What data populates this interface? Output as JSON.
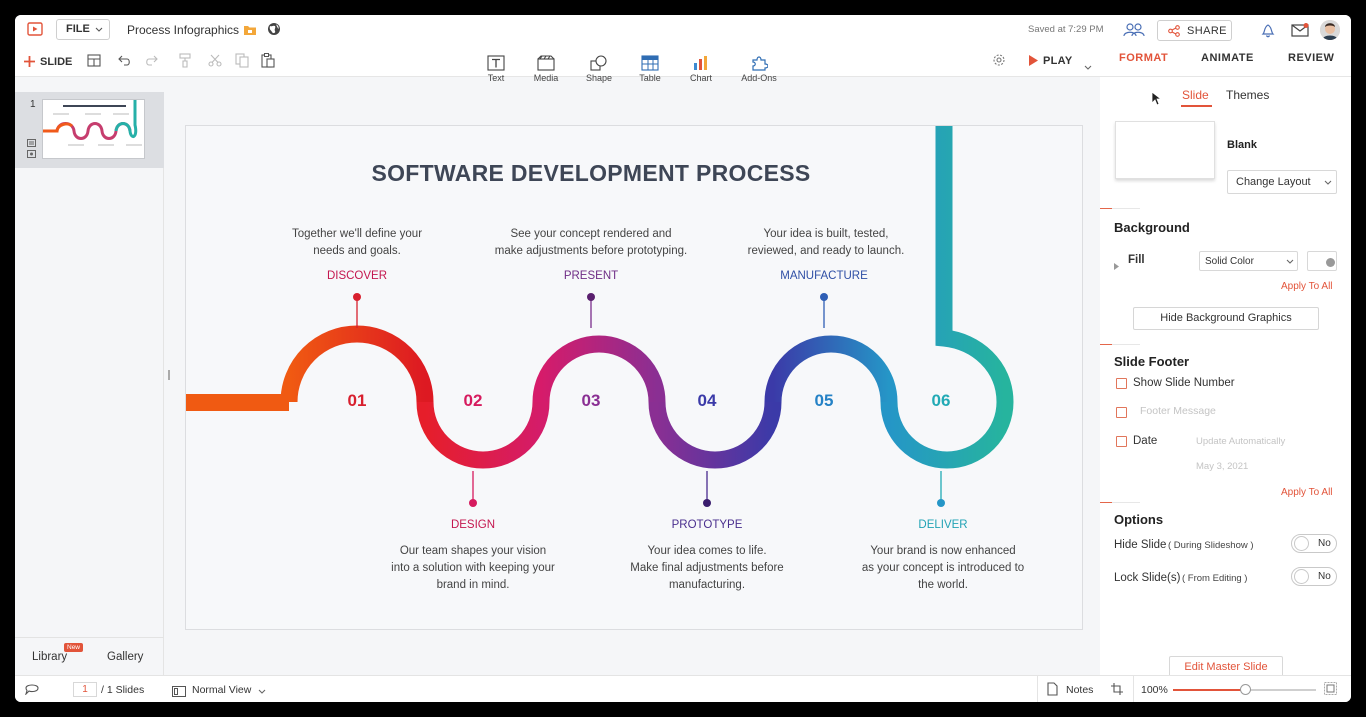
{
  "topbar": {
    "file_label": "FILE",
    "doc_title": "Process Infographics",
    "saved_status": "Saved at 7:29 PM",
    "share_label": "SHARE"
  },
  "toolbar": {
    "new_slide_label": "SLIDE",
    "insert": [
      {
        "label": "Text",
        "icon": "text-icon"
      },
      {
        "label": "Media",
        "icon": "media-icon"
      },
      {
        "label": "Shape",
        "icon": "shape-icon"
      },
      {
        "label": "Table",
        "icon": "table-icon"
      },
      {
        "label": "Chart",
        "icon": "chart-icon"
      },
      {
        "label": "Add-Ons",
        "icon": "addons-icon"
      }
    ],
    "play_label": "PLAY",
    "tabs": [
      "FORMAT",
      "ANIMATE",
      "REVIEW"
    ],
    "active_tab": "FORMAT"
  },
  "left_panel": {
    "slide_number": "1",
    "library_label": "Library",
    "library_badge": "New",
    "gallery_label": "Gallery"
  },
  "slide": {
    "title": "SOFTWARE DEVELOPMENT PROCESS",
    "steps": [
      {
        "num": "01",
        "name": "DISCOVER",
        "desc1": "Together we'll define your",
        "desc2": "needs and goals.",
        "desc3": "",
        "color": "#d8202e"
      },
      {
        "num": "02",
        "name": "DESIGN",
        "desc1": "Our team shapes your vision",
        "desc2": "into a solution with keeping your",
        "desc3": "brand in mind.",
        "color": "#d61b5e"
      },
      {
        "num": "03",
        "name": "PRESENT",
        "desc1": "See your concept rendered and",
        "desc2": "make adjustments before prototyping.",
        "desc3": "",
        "color": "#8a2f93"
      },
      {
        "num": "04",
        "name": "PROTOTYPE",
        "desc1": "Your idea comes to life.",
        "desc2": "Make final adjustments before",
        "desc3": "manufacturing.",
        "color": "#3b3aa8"
      },
      {
        "num": "05",
        "name": "MANUFACTURE",
        "desc1": "Your idea is built, tested,",
        "desc2": "reviewed, and ready to launch.",
        "desc3": "",
        "color": "#2582c6"
      },
      {
        "num": "06",
        "name": "DELIVER",
        "desc1": "Your brand is now enhanced",
        "desc2": "as your concept is introduced to",
        "desc3": "the world.",
        "color": "#22aab5"
      }
    ]
  },
  "format_panel": {
    "subtabs": [
      "Slide",
      "Themes"
    ],
    "active_subtab": "Slide",
    "layout_name": "Blank",
    "change_layout_label": "Change Layout",
    "background_heading": "Background",
    "fill_label": "Fill",
    "fill_value": "Solid Color",
    "apply_all_1": "Apply To All",
    "hide_bg_label": "Hide Background Graphics",
    "footer_heading": "Slide Footer",
    "show_slide_number": "Show Slide Number",
    "footer_message": "Footer Message",
    "date_label": "Date",
    "date_mode": "Update Automatically",
    "date_value": "May 3, 2021",
    "apply_all_2": "Apply To All",
    "options_heading": "Options",
    "hide_slide_label": "Hide Slide",
    "hide_slide_note": "( During Slideshow )",
    "hide_slide_value": "No",
    "lock_slide_label": "Lock Slide(s)",
    "lock_slide_note": "( From Editing )",
    "lock_slide_value": "No",
    "edit_master_label": "Edit Master Slide"
  },
  "statusbar": {
    "page_current": "1",
    "page_total": "/ 1 Slides",
    "view_label": "Normal View",
    "notes_label": "Notes",
    "zoom": "100%",
    "zoom_fraction": 0.5
  },
  "colors": {
    "accent": "#e2543a",
    "dark_text": "#3e4656"
  }
}
